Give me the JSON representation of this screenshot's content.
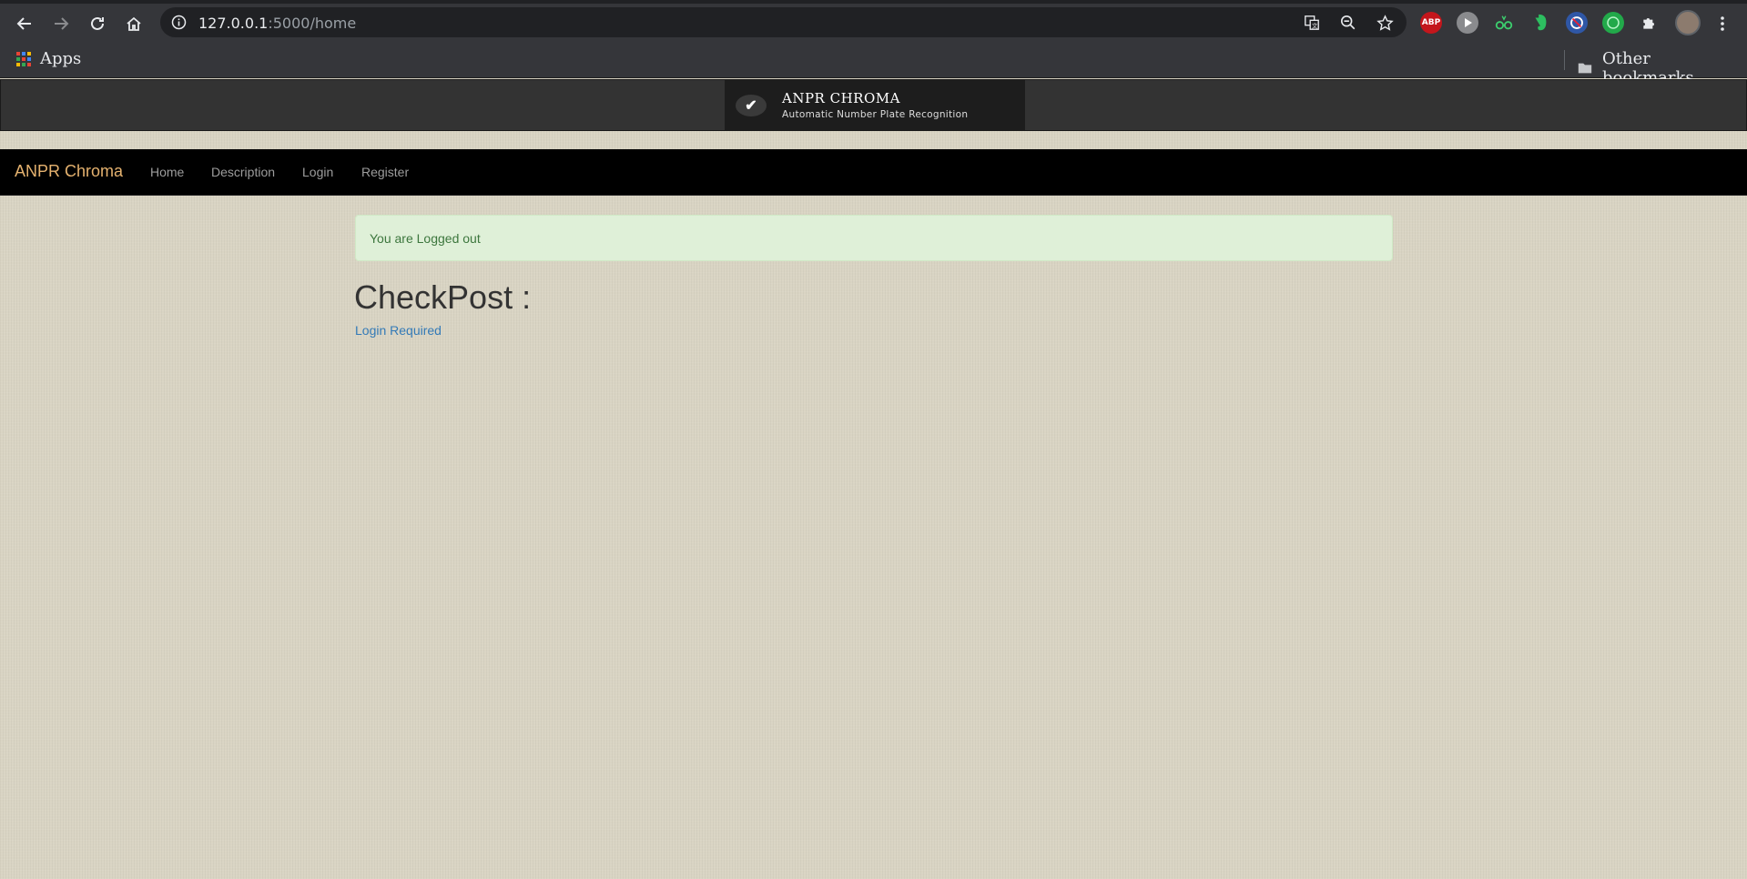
{
  "browser": {
    "url_host": "127.0.0.1",
    "url_path": ":5000/home",
    "bookmarks": {
      "apps_label": "Apps",
      "other_label": "Other bookmarks"
    },
    "extensions": [
      "abp-icon",
      "play-icon",
      "glasses-icon",
      "evernote-icon",
      "blocker-icon",
      "green-ext-icon",
      "puzzle-icon"
    ],
    "abp_label": "ABP"
  },
  "site": {
    "logo_title": "ANPR CHROMA",
    "logo_subtitle": "Automatic Number Plate Recognition",
    "brand": "ANPR Chroma",
    "nav": [
      "Home",
      "Description",
      "Login",
      "Register"
    ],
    "accent_color": "#e5b26f"
  },
  "main": {
    "alert": "You are Logged out",
    "heading": "CheckPost :",
    "login_link": "Login Required"
  }
}
